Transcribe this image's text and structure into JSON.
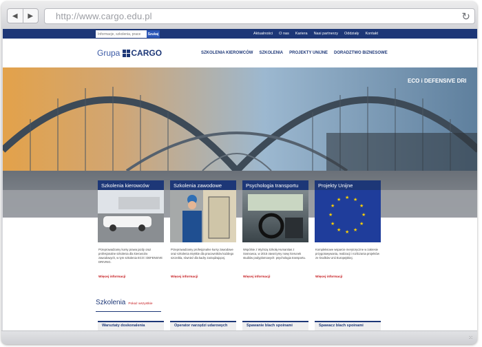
{
  "browser": {
    "url": "http://www.cargo.edu.pl",
    "back_icon": "back-arrow-icon",
    "forward_icon": "forward-arrow-icon",
    "reload_icon": "reload-icon"
  },
  "topbar": {
    "search_placeholder": "Informacje, szkolenia, prace",
    "search_button": "Szukaj",
    "links": [
      "Aktualności",
      "O nas",
      "Kariera",
      "Nasi partnerzy",
      "Oddziały",
      "Kontakt"
    ]
  },
  "header": {
    "logo_prefix": "Grupa",
    "logo_name": "CARGO",
    "nav": [
      "SZKOLENIA KIEROWCÓW",
      "SZKOLENIA",
      "PROJEKTY UNIJNE",
      "DORADZTWO BIZNESOWE"
    ]
  },
  "hero": {
    "title": "ECO i DEFENSIVE DRI"
  },
  "cards": [
    {
      "title": "Szkolenia kierowców",
      "text": "Przeprowadzamy kursy prawa jazdy oraz profesjonalne szkolenia dla kierowców zawodowych, w tym szkolenia ECO i DEFENSIVE DRIVING.",
      "more": "Więcej informacji"
    },
    {
      "title": "Szkolenia zawodowe",
      "text": "Przeprowadzamy profesjonalne kursy zawodowe oraz szkolenia miękkie dla pracowników każdego szczebla, również dla kadry zarządzającej.",
      "more": "Więcej informacji"
    },
    {
      "title": "Psychologia transportu",
      "text": "Wspólnie z Wyższą Szkołą Humanitas z Sosnowca, w 2015 otworzymy nowy kierunek studiów podyplomowych: psychologia transportu.",
      "more": "Więcej informacji"
    },
    {
      "title": "Projekty Unijne",
      "text": "Kompleksowe wsparcie merytoryczne w zakresie przygotowywania, realizacji i rozliczania projektów ze środków Unii Europejskiej.",
      "more": "Więcej informacji"
    }
  ],
  "trainings": {
    "heading": "Szkolenia",
    "show_all": "Pokaż wszystkie",
    "items": [
      "Warsztaty doskonalenia",
      "Operator narzędzi udarowych",
      "Spawanie blach spoinami",
      "Spawacz blach spoinami"
    ]
  },
  "colors": {
    "brand_blue": "#1d3777",
    "link_red": "#c4171b",
    "eu_yellow": "#ffd200"
  }
}
